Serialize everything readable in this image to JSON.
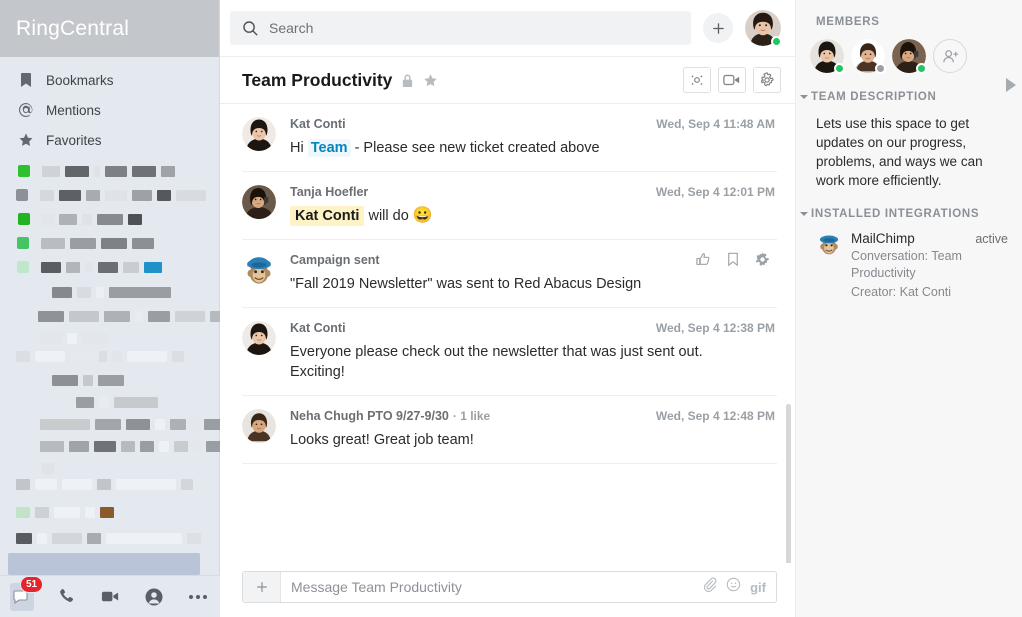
{
  "sidebar": {
    "logo": "RingCentral",
    "nav": [
      {
        "label": "Bookmarks",
        "icon": "bookmark-icon"
      },
      {
        "label": "Mentions",
        "icon": "at-icon"
      },
      {
        "label": "Favorites",
        "icon": "star-icon"
      }
    ],
    "bottom_nav": [
      {
        "name": "messages",
        "icon": "message-bubble-icon",
        "badge": "51",
        "active": true
      },
      {
        "name": "phone",
        "icon": "phone-icon",
        "badge": "",
        "active": false
      },
      {
        "name": "video",
        "icon": "video-camera-icon",
        "badge": "",
        "active": false
      },
      {
        "name": "contacts",
        "icon": "person-icon",
        "badge": "",
        "active": false
      },
      {
        "name": "more",
        "icon": "ellipsis-icon",
        "badge": "",
        "active": false
      }
    ]
  },
  "topbar": {
    "search_placeholder": "Search",
    "search_value": "",
    "add_label": "+",
    "user_presence": "online"
  },
  "conversation": {
    "title": "Team Productivity",
    "private": true,
    "favorite": true,
    "actions": [
      {
        "name": "share-button",
        "icon": "share-nodes-icon"
      },
      {
        "name": "video-call-button",
        "icon": "video-camera-icon"
      },
      {
        "name": "settings-button",
        "icon": "gear-icon"
      }
    ]
  },
  "messages": [
    {
      "author": "Kat Conti",
      "time": "Wed, Sep 4 11:48 AM",
      "likes": "",
      "avatar": "kat",
      "segments": [
        {
          "type": "text",
          "value": "Hi "
        },
        {
          "type": "mention",
          "value": "Team"
        },
        {
          "type": "text",
          "value": " - Please see new ticket created above"
        }
      ],
      "actions": []
    },
    {
      "author": "Tanja Hoefler",
      "time": "Wed, Sep 4 12:01 PM",
      "likes": "",
      "avatar": "tanja",
      "segments": [
        {
          "type": "mention-self",
          "value": "Kat Conti"
        },
        {
          "type": "text",
          "value": " will do "
        },
        {
          "type": "emoji",
          "value": "😀"
        }
      ],
      "actions": []
    },
    {
      "author": "Campaign sent",
      "time": "",
      "likes": "",
      "avatar": "mailchimp",
      "segments": [
        {
          "type": "text",
          "value": "\"Fall 2019 Newsletter\" was sent to Red Abacus Design"
        }
      ],
      "actions": [
        {
          "name": "like-button",
          "icon": "thumbs-up-icon"
        },
        {
          "name": "bookmark-button",
          "icon": "bookmark-icon"
        },
        {
          "name": "message-settings-button",
          "icon": "gear-icon"
        }
      ]
    },
    {
      "author": "Kat Conti",
      "time": "Wed, Sep 4 12:38 PM",
      "likes": "",
      "avatar": "kat",
      "segments": [
        {
          "type": "text",
          "value": "Everyone please check out the newsletter that was just sent out. Exciting!"
        }
      ],
      "actions": []
    },
    {
      "author": "Neha Chugh PTO 9/27-9/30",
      "time": "Wed, Sep 4 12:48 PM",
      "likes": "· 1 like",
      "avatar": "neha",
      "segments": [
        {
          "type": "text",
          "value": "Looks great! Great job team!"
        }
      ],
      "actions": []
    }
  ],
  "composer": {
    "placeholder": "Message Team Productivity",
    "value": "",
    "icons": [
      {
        "name": "attach-file-button",
        "icon": "paperclip-icon"
      },
      {
        "name": "emoji-button",
        "icon": "smiley-icon"
      },
      {
        "name": "gif-button",
        "icon": "gif-icon",
        "label": "gif"
      }
    ]
  },
  "rightpanel": {
    "members_heading": "MEMBERS",
    "members": [
      {
        "avatar": "kat",
        "presence": "online"
      },
      {
        "avatar": "neha",
        "presence": "offline"
      },
      {
        "avatar": "tanja",
        "presence": "online"
      }
    ],
    "add_member_label": "add-member",
    "description_heading": "TEAM DESCRIPTION",
    "description": "Lets use this space to get updates on our progress, problems, and ways we can work more efficiently.",
    "integrations_heading": "INSTALLED INTEGRATIONS",
    "integrations": [
      {
        "name": "MailChimp",
        "status": "active",
        "conversation": "Conversation: Team Productivity",
        "creator": "Creator: Kat Conti"
      }
    ]
  },
  "colors": {
    "sidebar_bg": "#e4e8ef",
    "logo_bar": "#c3c6cb",
    "mention_blue": "#0684bd",
    "mention_self_bg": "#fdf3c6",
    "presence_online": "#1ec760",
    "presence_offline": "#9aa0a6",
    "badge_red": "#e8222a"
  }
}
